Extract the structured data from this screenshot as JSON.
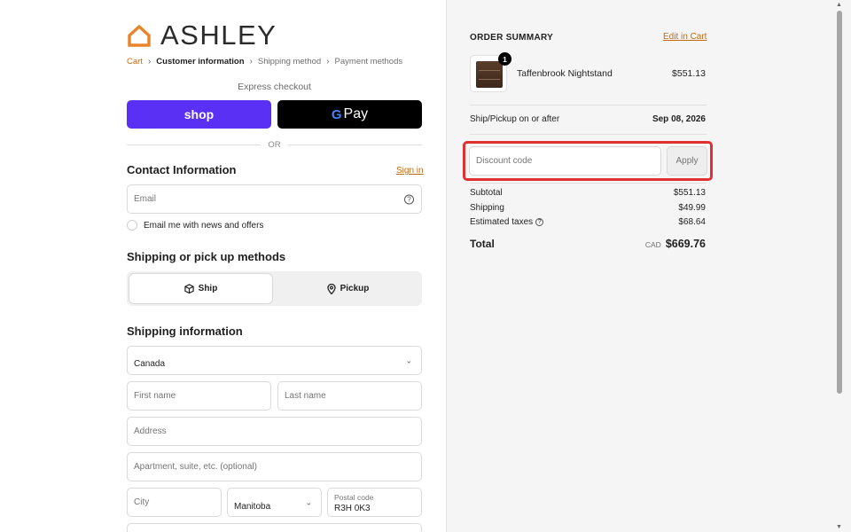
{
  "brand": {
    "name": "ASHLEY",
    "logo_icon": "house-outline-icon",
    "accent": "#e8842a"
  },
  "breadcrumb": {
    "items": [
      "Cart",
      "Customer information",
      "Shipping method",
      "Payment methods"
    ]
  },
  "express": {
    "label": "Express checkout",
    "shop_label": "shop",
    "gpay_g": "G",
    "gpay_label": "Pay",
    "or_label": "OR"
  },
  "contact": {
    "title": "Contact Information",
    "signin_label": "Sign in",
    "email_placeholder": "Email",
    "help_icon": "?",
    "newsletter_label": "Email me with news and offers"
  },
  "methods": {
    "title": "Shipping or pick up methods",
    "ship_label": "Ship",
    "pickup_label": "Pickup"
  },
  "shipping": {
    "title": "Shipping information",
    "country_value": "Canada",
    "first_name_placeholder": "First name",
    "last_name_placeholder": "Last name",
    "address_placeholder": "Address",
    "apartment_placeholder": "Apartment, suite, etc. (optional)",
    "city_placeholder": "City",
    "province_value": "Manitoba",
    "postal_label": "Postal code",
    "postal_value": "R3H 0K3"
  },
  "summary": {
    "title": "ORDER SUMMARY",
    "edit_cart_label": "Edit in Cart",
    "product": {
      "name": "Taffenbrook Nightstand",
      "price": "$551.13",
      "quantity": "1"
    },
    "ship_label": "Ship/Pickup on or after",
    "ship_date": "Sep 08, 2026",
    "discount_placeholder": "Discount code",
    "apply_label": "Apply",
    "subtotal_label": "Subtotal",
    "subtotal_value": "$551.13",
    "shipping_label": "Shipping",
    "shipping_value": "$49.99",
    "taxes_label": "Estimated taxes",
    "taxes_value": "$68.64",
    "total_label": "Total",
    "total_currency": "CAD",
    "total_value": "$669.76"
  }
}
